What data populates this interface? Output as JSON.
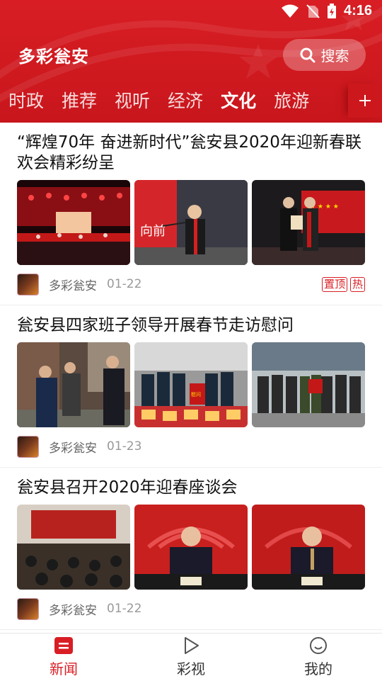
{
  "status": {
    "time": "4:16"
  },
  "header": {
    "app_title": "多彩瓮安",
    "search_label": "搜索"
  },
  "tabs": [
    {
      "label": "时政"
    },
    {
      "label": "推荐"
    },
    {
      "label": "视听"
    },
    {
      "label": "经济"
    },
    {
      "label": "文化",
      "active": true
    },
    {
      "label": "旅游"
    }
  ],
  "articles": [
    {
      "title": "“辉煌70年 奋进新时代”瓮安县2020年迎新春联欢会精彩纷呈",
      "source": "多彩瓮安",
      "date": "01-22",
      "badges": [
        "置顶",
        "热"
      ]
    },
    {
      "title": "瓮安县四家班子领导开展春节走访慰问",
      "source": "多彩瓮安",
      "date": "01-23",
      "badges": []
    },
    {
      "title": "瓮安县召开2020年迎春座谈会",
      "source": "多彩瓮安",
      "date": "01-22",
      "badges": []
    }
  ],
  "bottom_nav": [
    {
      "label": "新闻",
      "icon": "news-icon",
      "active": true
    },
    {
      "label": "彩视",
      "icon": "play-icon"
    },
    {
      "label": "我的",
      "icon": "smile-icon"
    }
  ],
  "colors": {
    "brand_red": "#d81e24"
  }
}
